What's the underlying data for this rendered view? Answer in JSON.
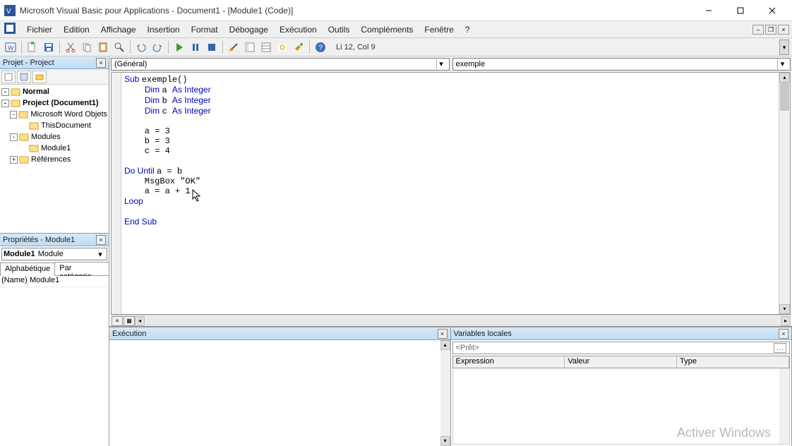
{
  "title": "Microsoft Visual Basic pour Applications - Document1 - [Module1 (Code)]",
  "menu": [
    "Fichier",
    "Edition",
    "Affichage",
    "Insertion",
    "Format",
    "Débogage",
    "Exécution",
    "Outils",
    "Compléments",
    "Fenêtre",
    "?"
  ],
  "toolbar_status": "Li 12, Col 9",
  "project_panel": {
    "title": "Projet - Project",
    "items": [
      {
        "level": 0,
        "exp": "-",
        "bold": true,
        "label": "Normal"
      },
      {
        "level": 0,
        "exp": "-",
        "bold": true,
        "label": "Project (Document1)"
      },
      {
        "level": 1,
        "exp": "-",
        "bold": false,
        "label": "Microsoft Word Objets"
      },
      {
        "level": 2,
        "exp": "",
        "bold": false,
        "label": "ThisDocument"
      },
      {
        "level": 1,
        "exp": "-",
        "bold": false,
        "label": "Modules"
      },
      {
        "level": 2,
        "exp": "",
        "bold": false,
        "label": "Module1"
      },
      {
        "level": 1,
        "exp": "+",
        "bold": false,
        "label": "Références"
      }
    ]
  },
  "props_panel": {
    "title": "Propriétés - Module1",
    "combo_name": "Module1",
    "combo_type": "Module",
    "tabs": [
      "Alphabétique",
      "Par catégorie"
    ],
    "rows": [
      {
        "k": "(Name)",
        "v": "Module1"
      }
    ]
  },
  "code_dropdowns": {
    "left": "(Général)",
    "right": "exemple"
  },
  "code": {
    "lines": [
      {
        "t": "Sub ",
        "kw": true,
        "rest": "exemple()"
      },
      {
        "indent": "    ",
        "kw": "Dim ",
        "rest": "a ",
        "kw2": "As Integer"
      },
      {
        "indent": "    ",
        "kw": "Dim ",
        "rest": "b ",
        "kw2": "As Integer"
      },
      {
        "indent": "    ",
        "kw": "Dim ",
        "rest": "c ",
        "kw2": "As Integer"
      },
      {
        "blank": true
      },
      {
        "indent": "    ",
        "rest": "a = 3"
      },
      {
        "indent": "    ",
        "rest": "b = 3"
      },
      {
        "indent": "    ",
        "rest": "c = 4"
      },
      {
        "blank": true
      },
      {
        "kw": "Do Until ",
        "rest": "a = b"
      },
      {
        "indent": "    ",
        "rest": "MsgBox \"OK\""
      },
      {
        "indent": "    ",
        "rest": "a = a + 1"
      },
      {
        "kw": "Loop"
      },
      {
        "blank": true
      },
      {
        "kw": "End Sub"
      }
    ]
  },
  "exec_panel": {
    "title": "Exécution"
  },
  "locals_panel": {
    "title": "Variables locales",
    "context": "<Prêt>",
    "cols": [
      "Expression",
      "Valeur",
      "Type"
    ]
  },
  "watermark": "Activer Windows"
}
